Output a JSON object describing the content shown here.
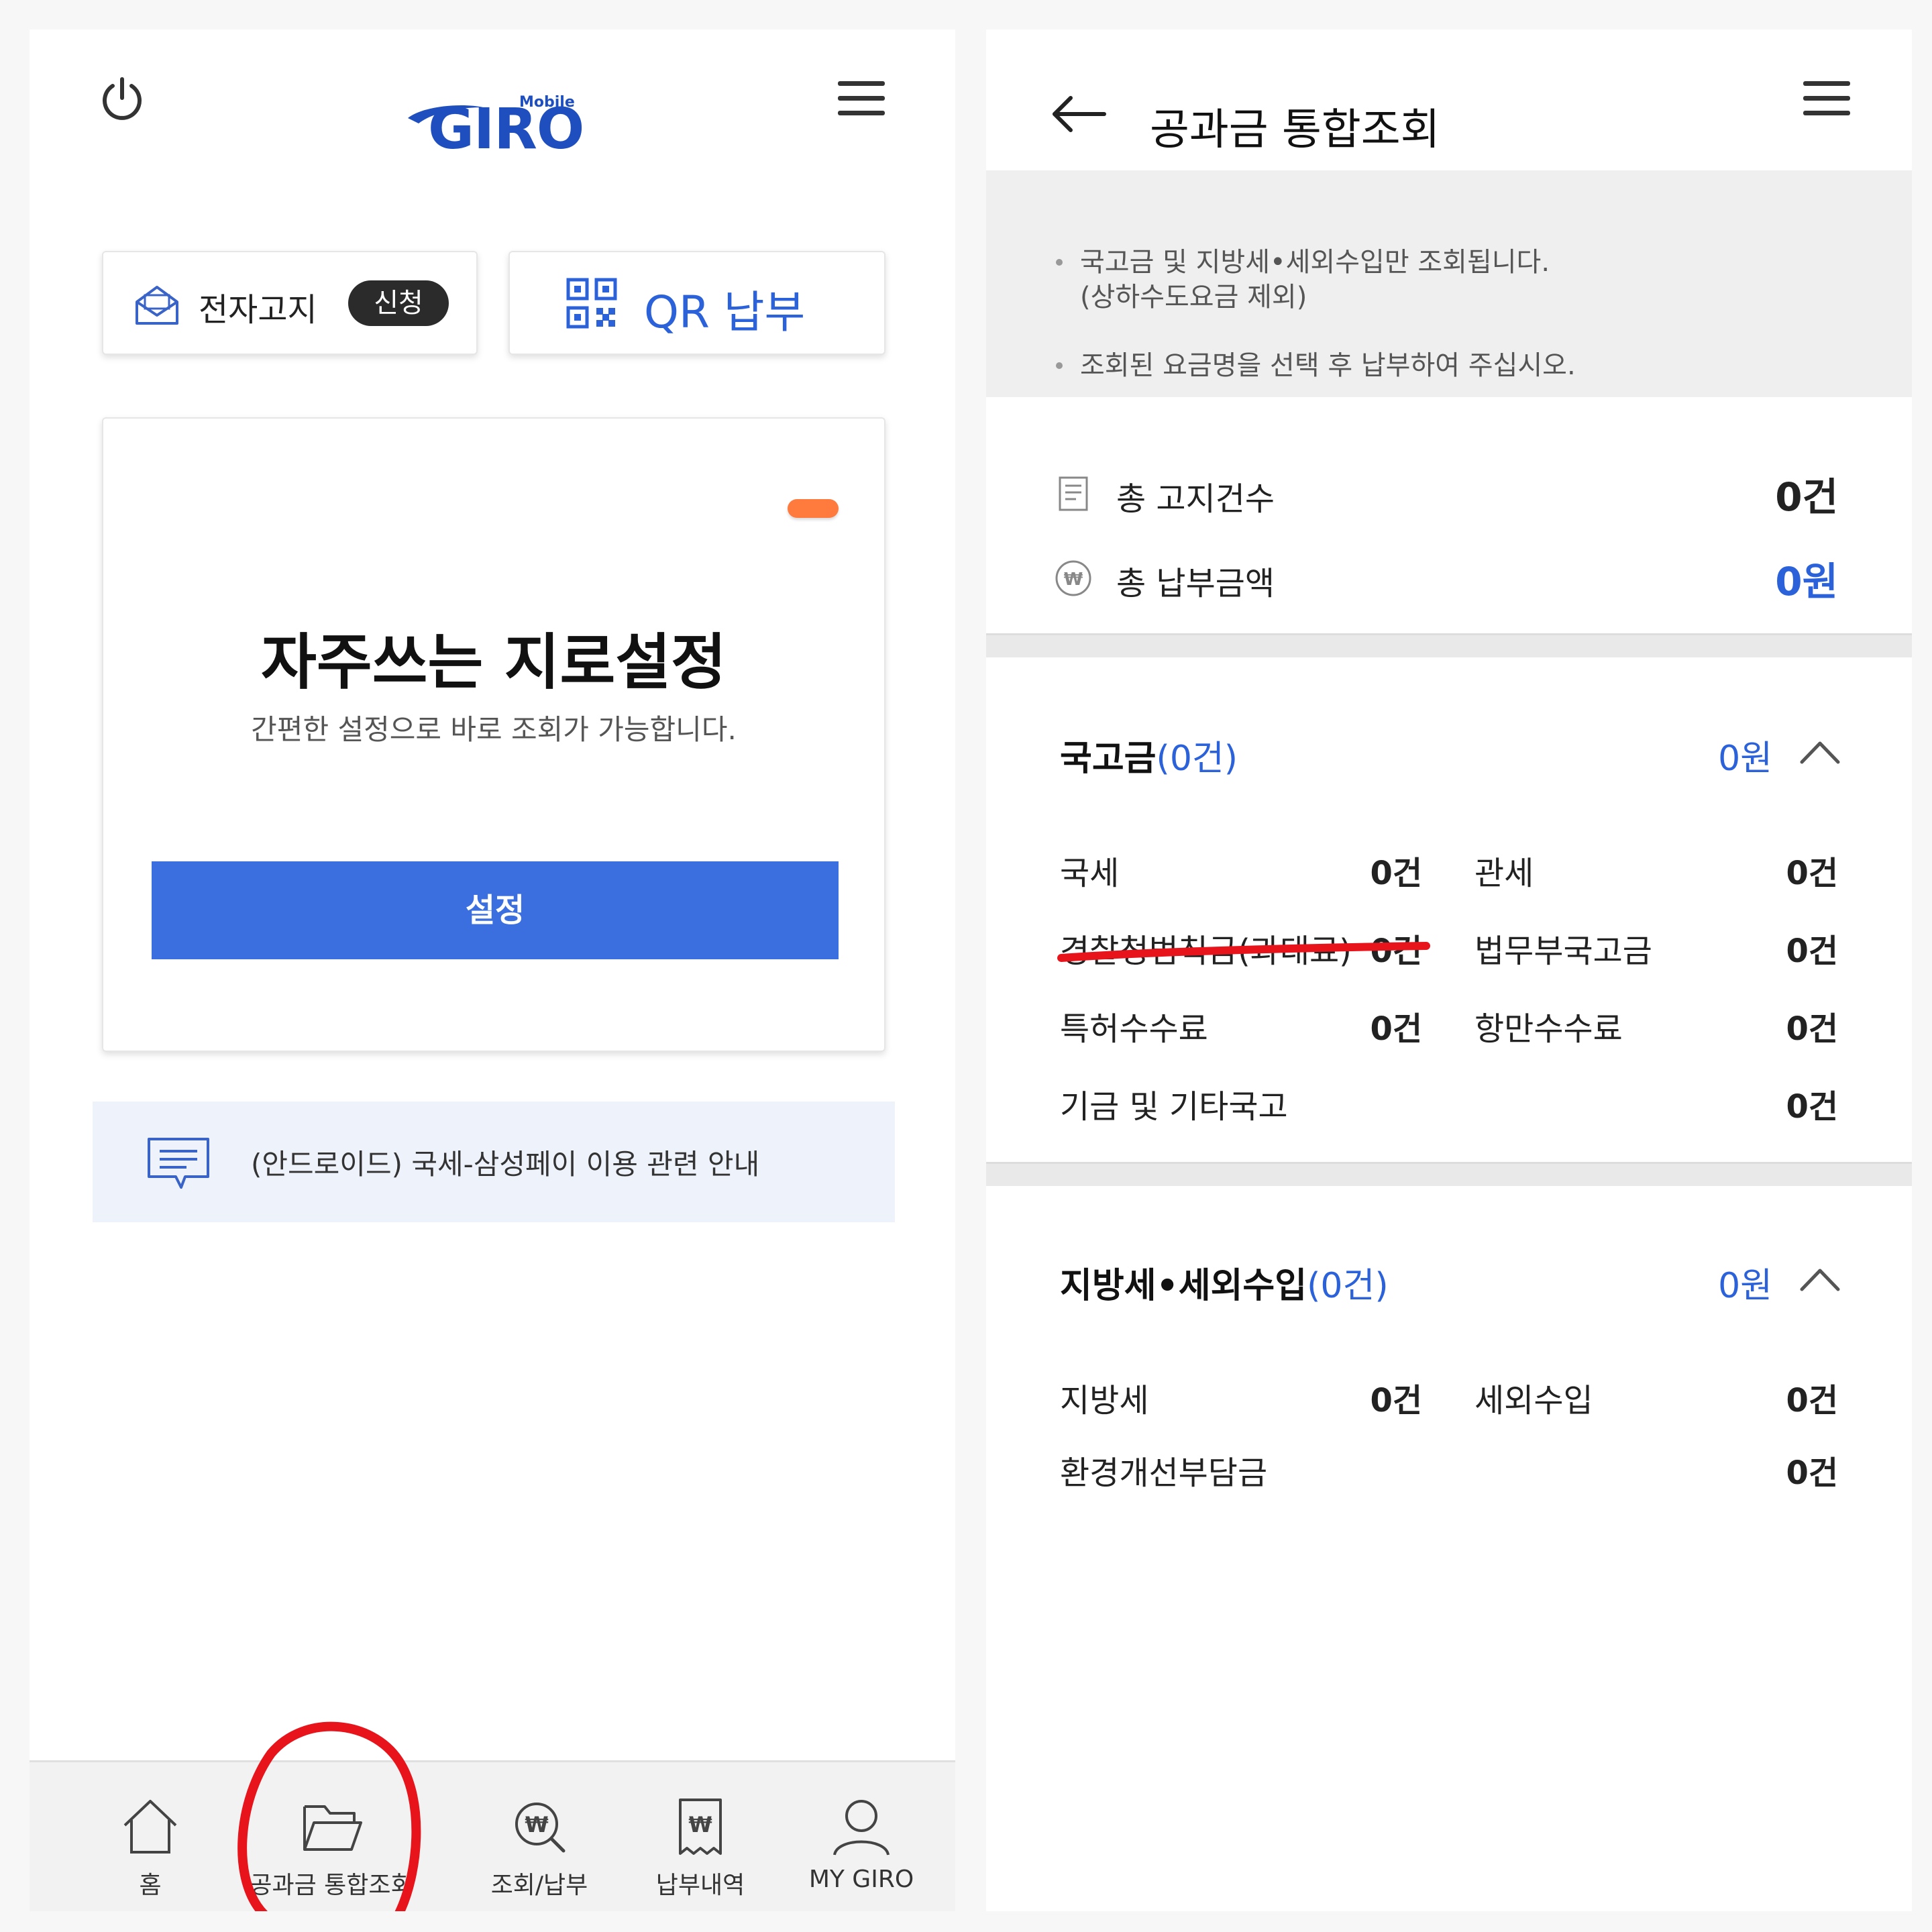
{
  "left": {
    "logo": {
      "small": "Mobile",
      "brand": "GIRO"
    },
    "ebill": {
      "label": "전자고지",
      "badge": "신청"
    },
    "qr": {
      "label": "QR 납부"
    },
    "giro_card": {
      "title": "자주쓰는 지로설정",
      "subtitle": "간편한 설정으로 바로 조회가 가능합니다.",
      "button": "설정"
    },
    "notice": "(안드로이드) 국세-삼성페이 이용 관련 안내",
    "nav": [
      {
        "label": "홈",
        "icon": "home-icon"
      },
      {
        "label": "공과금 통합조회",
        "icon": "folder-icon"
      },
      {
        "label": "조회/납부",
        "icon": "search-won-icon"
      },
      {
        "label": "납부내역",
        "icon": "receipt-won-icon"
      },
      {
        "label": "MY GIRO",
        "icon": "user-icon"
      }
    ]
  },
  "right": {
    "title": "공과금 통합조회",
    "info": [
      "국고금 및 지방세•세외수입만 조회됩니다.",
      "(상하수도요금 제외)",
      "조회된 요금명을 선택 후 납부하여 주십시오."
    ],
    "summary": {
      "total_notices_label": "총 고지건수",
      "total_notices_value": "0건",
      "total_amount_label": "총 납부금액",
      "total_amount_value": "0원"
    },
    "national": {
      "title": "국고금",
      "count": "(0건)",
      "amount": "0원",
      "items": [
        {
          "name": "국세",
          "count": "0건"
        },
        {
          "name": "관세",
          "count": "0건"
        },
        {
          "name": "경찰청범칙금(과태료)",
          "count": "0건"
        },
        {
          "name": "법무부국고금",
          "count": "0건"
        },
        {
          "name": "특허수수료",
          "count": "0건"
        },
        {
          "name": "항만수수료",
          "count": "0건"
        },
        {
          "name": "기금 및 기타국고",
          "count": "0건"
        }
      ]
    },
    "local": {
      "title": "지방세•세외수입",
      "count": "(0건)",
      "amount": "0원",
      "items": [
        {
          "name": "지방세",
          "count": "0건"
        },
        {
          "name": "세외수입",
          "count": "0건"
        },
        {
          "name": "환경개선부담금",
          "count": "0건"
        }
      ]
    }
  },
  "colors": {
    "brand_blue": "#2c62d9",
    "button_blue": "#3b6fe0",
    "accent_orange": "#ff7a3d",
    "annotation_red": "#e8141c"
  }
}
